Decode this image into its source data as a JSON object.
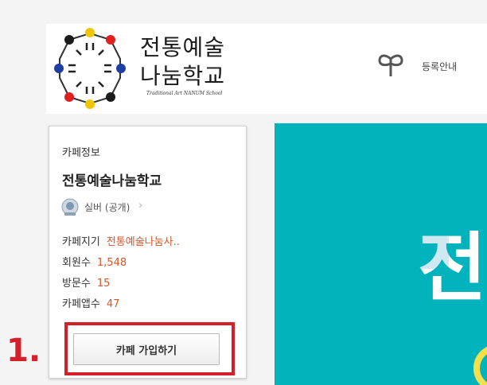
{
  "header": {
    "logo_title_line1": "전통예술",
    "logo_title_line2": "나눔학교",
    "logo_subtitle": "Traditional Art NANUM School",
    "register_label": "등록안내",
    "register_icon": "sprout-icon"
  },
  "cafe_info": {
    "section_label": "카페정보",
    "cafe_name": "전통예술나눔학교",
    "grade": "실버 (공개)",
    "grade_icon": "medal-icon",
    "stats": [
      {
        "label": "카페지기",
        "value": "전통예술나눔사.."
      },
      {
        "label": "회원수",
        "value": "1,548"
      },
      {
        "label": "방문수",
        "value": "15"
      },
      {
        "label": "카페앱수",
        "value": "47"
      }
    ],
    "join_button": "카페 가입하기"
  },
  "annotation": {
    "step": "1.",
    "color": "#d3202a"
  },
  "banner": {
    "visible_text": "전",
    "bg_color": "#00b3bd"
  },
  "colors": {
    "value_accent": "#d2572b",
    "logo_blue": "#1f3fa0",
    "logo_red": "#e02020",
    "logo_yellow": "#f2c500"
  }
}
